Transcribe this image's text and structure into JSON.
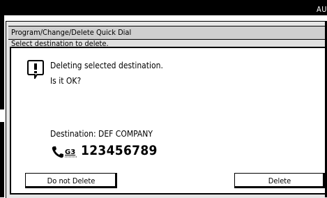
{
  "status": {
    "corner_text": "AU"
  },
  "window": {
    "title": "Program/Change/Delete Quick Dial",
    "subtitle": "Select destination to delete."
  },
  "dialog": {
    "icon": "exclamation-alert-icon",
    "message_line1": "Deleting selected destination.",
    "message_line2": "Is it OK?",
    "destination_text": "Destination: DEF COMPANY",
    "phone_icon": "fax-g3-phone-icon",
    "phone_line_label": "G3",
    "phone_number": "123456789",
    "buttons": {
      "cancel_label": "Do not Delete",
      "confirm_label": "Delete"
    }
  }
}
